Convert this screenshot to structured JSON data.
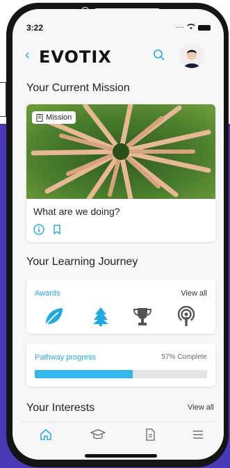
{
  "status": {
    "time": "3:22"
  },
  "header": {
    "logo": "EVOTIX"
  },
  "mission": {
    "section_title": "Your Current Mission",
    "badge_label": "Mission",
    "question": "What are we doing?"
  },
  "learning": {
    "section_title": "Your Learning Journey",
    "awards_label": "Awards",
    "awards_view_all": "View all",
    "awards": [
      {
        "icon": "leaf-icon",
        "color": "#1fa9e1"
      },
      {
        "icon": "tree-icon",
        "color": "#1fa9e1"
      },
      {
        "icon": "trophy-icon",
        "color": "#555555"
      },
      {
        "icon": "podcast-icon",
        "color": "#555555"
      }
    ],
    "pathway_label": "Pathway progress",
    "pathway_progress_text": "57% Complete",
    "pathway_progress_value": 0.57
  },
  "interests": {
    "section_title": "Your Interests",
    "view_all": "View all"
  },
  "tabbar": {
    "items": [
      "home-icon",
      "graduation-cap-icon",
      "document-icon",
      "menu-icon"
    ],
    "active_color": "#1fa9e1"
  },
  "colors": {
    "accent": "#1fa9e1",
    "background_purple": "#4a3ab8"
  }
}
